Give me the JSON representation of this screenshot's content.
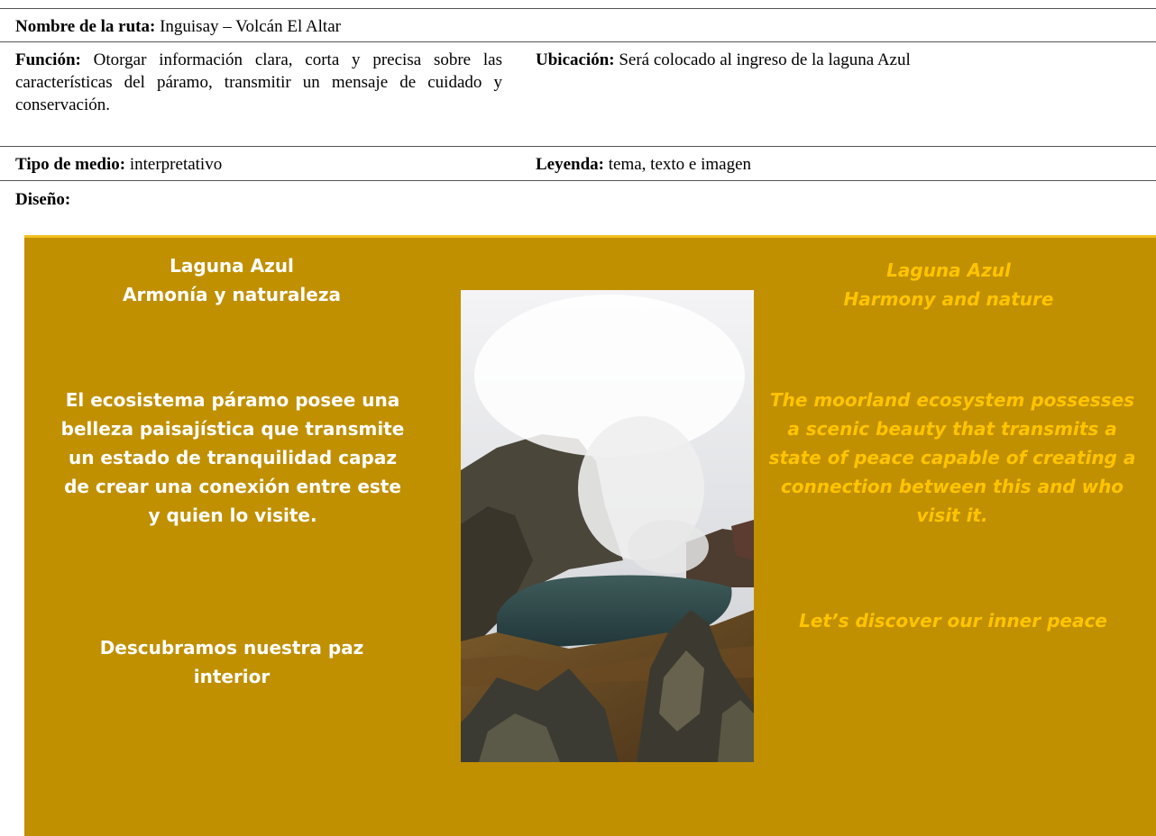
{
  "route": {
    "label": "Nombre de la ruta:",
    "value": "Inguisay – Volcán El Altar"
  },
  "function": {
    "label": "Función:",
    "value": "Otorgar información clara, corta y precisa sobre las características del páramo, transmitir un mensaje de cuidado y conservación."
  },
  "location": {
    "label": "Ubicación:",
    "value": "Será colocado al ingreso de la laguna Azul"
  },
  "media_type": {
    "label": "Tipo de medio:",
    "value": "interpretativo"
  },
  "legend": {
    "label": "Leyenda:",
    "value": "tema, texto e imagen"
  },
  "design": {
    "label": "Diseño:"
  },
  "poster": {
    "background_color": "#c09000",
    "spanish": {
      "title_line1": "Laguna Azul",
      "title_line2": "Armonía y naturaleza",
      "body": "El ecosistema páramo posee una belleza paisajística que transmite un estado de tranquilidad capaz de crear una conexión entre este y quien lo visite.",
      "cta": "Descubramos nuestra paz interior"
    },
    "english": {
      "title_line1": "Laguna Azul",
      "title_line2": "Harmony and nature",
      "body": "The moorland ecosystem possesses a scenic beauty that transmits a state of peace capable of creating a connection between this and who visit it.",
      "cta": "Let’s discover our inner peace"
    },
    "photo_icon": "lagoon-photo"
  }
}
